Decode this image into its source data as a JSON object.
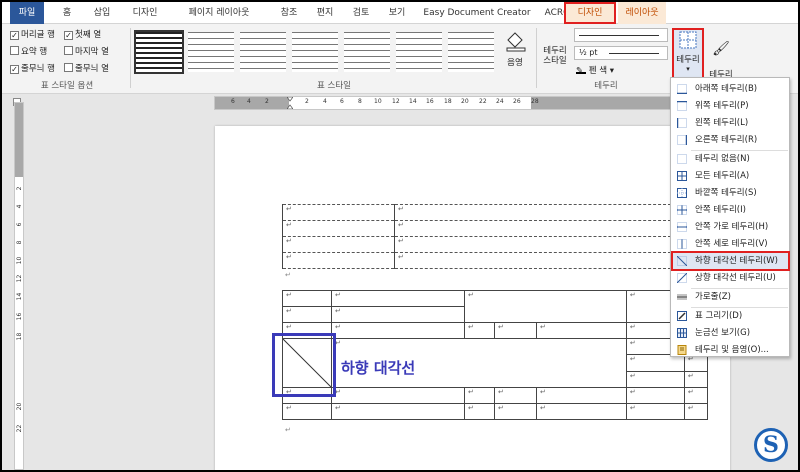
{
  "tabs": [
    "파일",
    "홈",
    "삽입",
    "디자인",
    "페이지 레이아웃",
    "참조",
    "편지",
    "검토",
    "보기",
    "Easy Document Creator",
    "ACROBAT",
    "디자인",
    "레이아웃"
  ],
  "table_style_options": {
    "items": [
      {
        "label": "머리글 행",
        "checked": true
      },
      {
        "label": "첫째 열",
        "checked": true
      },
      {
        "label": "요약 행",
        "checked": false
      },
      {
        "label": "마지막 열",
        "checked": false
      },
      {
        "label": "줄무늬 행",
        "checked": true
      },
      {
        "label": "줄무늬 열",
        "checked": false
      }
    ],
    "group_label": "표 스타일 옵션"
  },
  "table_styles": {
    "group_label": "표 스타일"
  },
  "shading": {
    "label": "음영"
  },
  "borders": {
    "border_styles_label": "테두리\n스타일",
    "weight": "½ pt",
    "pen_color": "펜 색",
    "borders_button": "테두리",
    "border_painter": "테두리\n복사",
    "group_label": "테두리"
  },
  "ruler_h": [
    "6",
    "4",
    "2",
    "2",
    "4",
    "6",
    "8",
    "10",
    "12",
    "14",
    "16",
    "18",
    "20",
    "22",
    "24",
    "26",
    "28"
  ],
  "ruler_v": [
    "2",
    "4",
    "6",
    "8",
    "10",
    "12",
    "14",
    "16",
    "18",
    "20",
    "22"
  ],
  "menu": {
    "items": [
      {
        "label": "아래쪽 테두리(B)"
      },
      {
        "label": "위쪽 테두리(P)"
      },
      {
        "label": "왼쪽 테두리(L)"
      },
      {
        "label": "오른쪽 테두리(R)"
      },
      {
        "label": "테두리 없음(N)"
      },
      {
        "label": "모든 테두리(A)"
      },
      {
        "label": "바깥쪽 테두리(S)"
      },
      {
        "label": "안쪽 테두리(I)"
      },
      {
        "label": "안쪽 가로 테두리(H)"
      },
      {
        "label": "안쪽 세로 테두리(V)"
      },
      {
        "label": "하향 대각선 테두리(W)"
      },
      {
        "label": "상향 대각선 테두리(U)"
      },
      {
        "label": "가로줄(Z)"
      },
      {
        "label": "표 그리기(D)"
      },
      {
        "label": "눈금선 보기(G)"
      },
      {
        "label": "테두리 및 음영(O)..."
      }
    ]
  },
  "annotation": "하향 대각선",
  "paragraph_mark": "↵",
  "logo": "S"
}
